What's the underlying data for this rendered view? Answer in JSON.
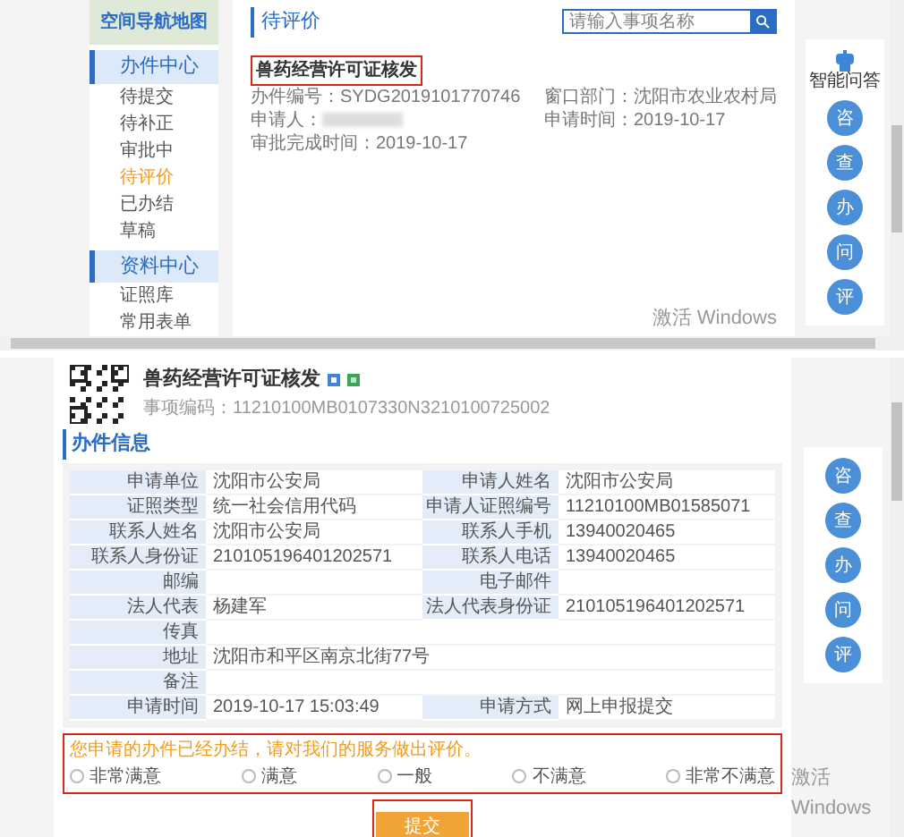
{
  "top": {
    "sidebar": {
      "logo_text": "空间导航地图",
      "sections": [
        {
          "title": "办件中心",
          "items": [
            {
              "label": "待提交",
              "selected": false
            },
            {
              "label": "待补正",
              "selected": false
            },
            {
              "label": "审批中",
              "selected": false
            },
            {
              "label": "待评价",
              "selected": true
            },
            {
              "label": "已办结",
              "selected": false
            },
            {
              "label": "草稿",
              "selected": false
            }
          ]
        },
        {
          "title": "资料中心",
          "items": [
            {
              "label": "证照库",
              "selected": false
            },
            {
              "label": "常用表单",
              "selected": false
            }
          ]
        }
      ]
    },
    "page_title": "待评价",
    "search": {
      "placeholder": "请输入事项名称"
    },
    "item": {
      "title": "兽药经营许可证核发",
      "fields": [
        {
          "label": "办件编号：",
          "value": "SYDG2019101770746"
        },
        {
          "label": "窗口部门：",
          "value": "沈阳市农业农村局"
        },
        {
          "label": "申请人：",
          "redacted": true
        },
        {
          "label": "申请时间：",
          "value": "2019-10-17"
        },
        {
          "label": "审批完成时间：",
          "value": "2019-10-17"
        }
      ]
    },
    "assistant": {
      "label": "智能问答"
    },
    "quick_buttons": [
      "咨",
      "查",
      "办",
      "问",
      "评"
    ],
    "activation_notice": "激活 Windows"
  },
  "bottom": {
    "title": "兽药经营许可证核发",
    "code": "事项编码：11210100MB0107330N3210100725002",
    "section_title": "办件信息",
    "rows": [
      [
        {
          "label": "申请单位",
          "value": "沈阳市公安局"
        },
        {
          "label": "申请人姓名",
          "value": "沈阳市公安局"
        }
      ],
      [
        {
          "label": "证照类型",
          "value": "统一社会信用代码"
        },
        {
          "label": "申请人证照编号",
          "value": "11210100MB01585071"
        }
      ],
      [
        {
          "label": "联系人姓名",
          "value": "沈阳市公安局"
        },
        {
          "label": "联系人手机",
          "value": "13940020465"
        }
      ],
      [
        {
          "label": "联系人身份证",
          "value": "210105196401202571"
        },
        {
          "label": "联系人电话",
          "value": "13940020465"
        }
      ],
      [
        {
          "label": "邮编"
        },
        {
          "label": "电子邮件"
        }
      ],
      [
        {
          "label": "法人代表",
          "value": "杨建军"
        },
        {
          "label": "法人代表身份证",
          "value": "210105196401202571"
        }
      ],
      [
        {
          "label": "传真"
        }
      ],
      [
        {
          "label": "地址",
          "value": "沈阳市和平区南京北街77号"
        }
      ],
      [
        {
          "label": "备注"
        }
      ],
      [
        {
          "label": "申请时间",
          "value": "2019-10-17 15:03:49"
        },
        {
          "label": "申请方式",
          "value": "网上申报提交"
        }
      ]
    ],
    "rating_prompt": "您申请的办件已经办结，请对我们的服务做出评价。",
    "ratings": [
      {
        "label": "非常满意",
        "selected": false
      },
      {
        "label": "满意",
        "selected": false
      },
      {
        "label": "一般",
        "selected": false
      },
      {
        "label": "不满意",
        "selected": false
      },
      {
        "label": "非常不满意",
        "selected": false
      }
    ],
    "submit": "提交",
    "quick_buttons": [
      "咨",
      "查",
      "办",
      "问",
      "评"
    ],
    "activation_notice": "激活 Windows"
  }
}
